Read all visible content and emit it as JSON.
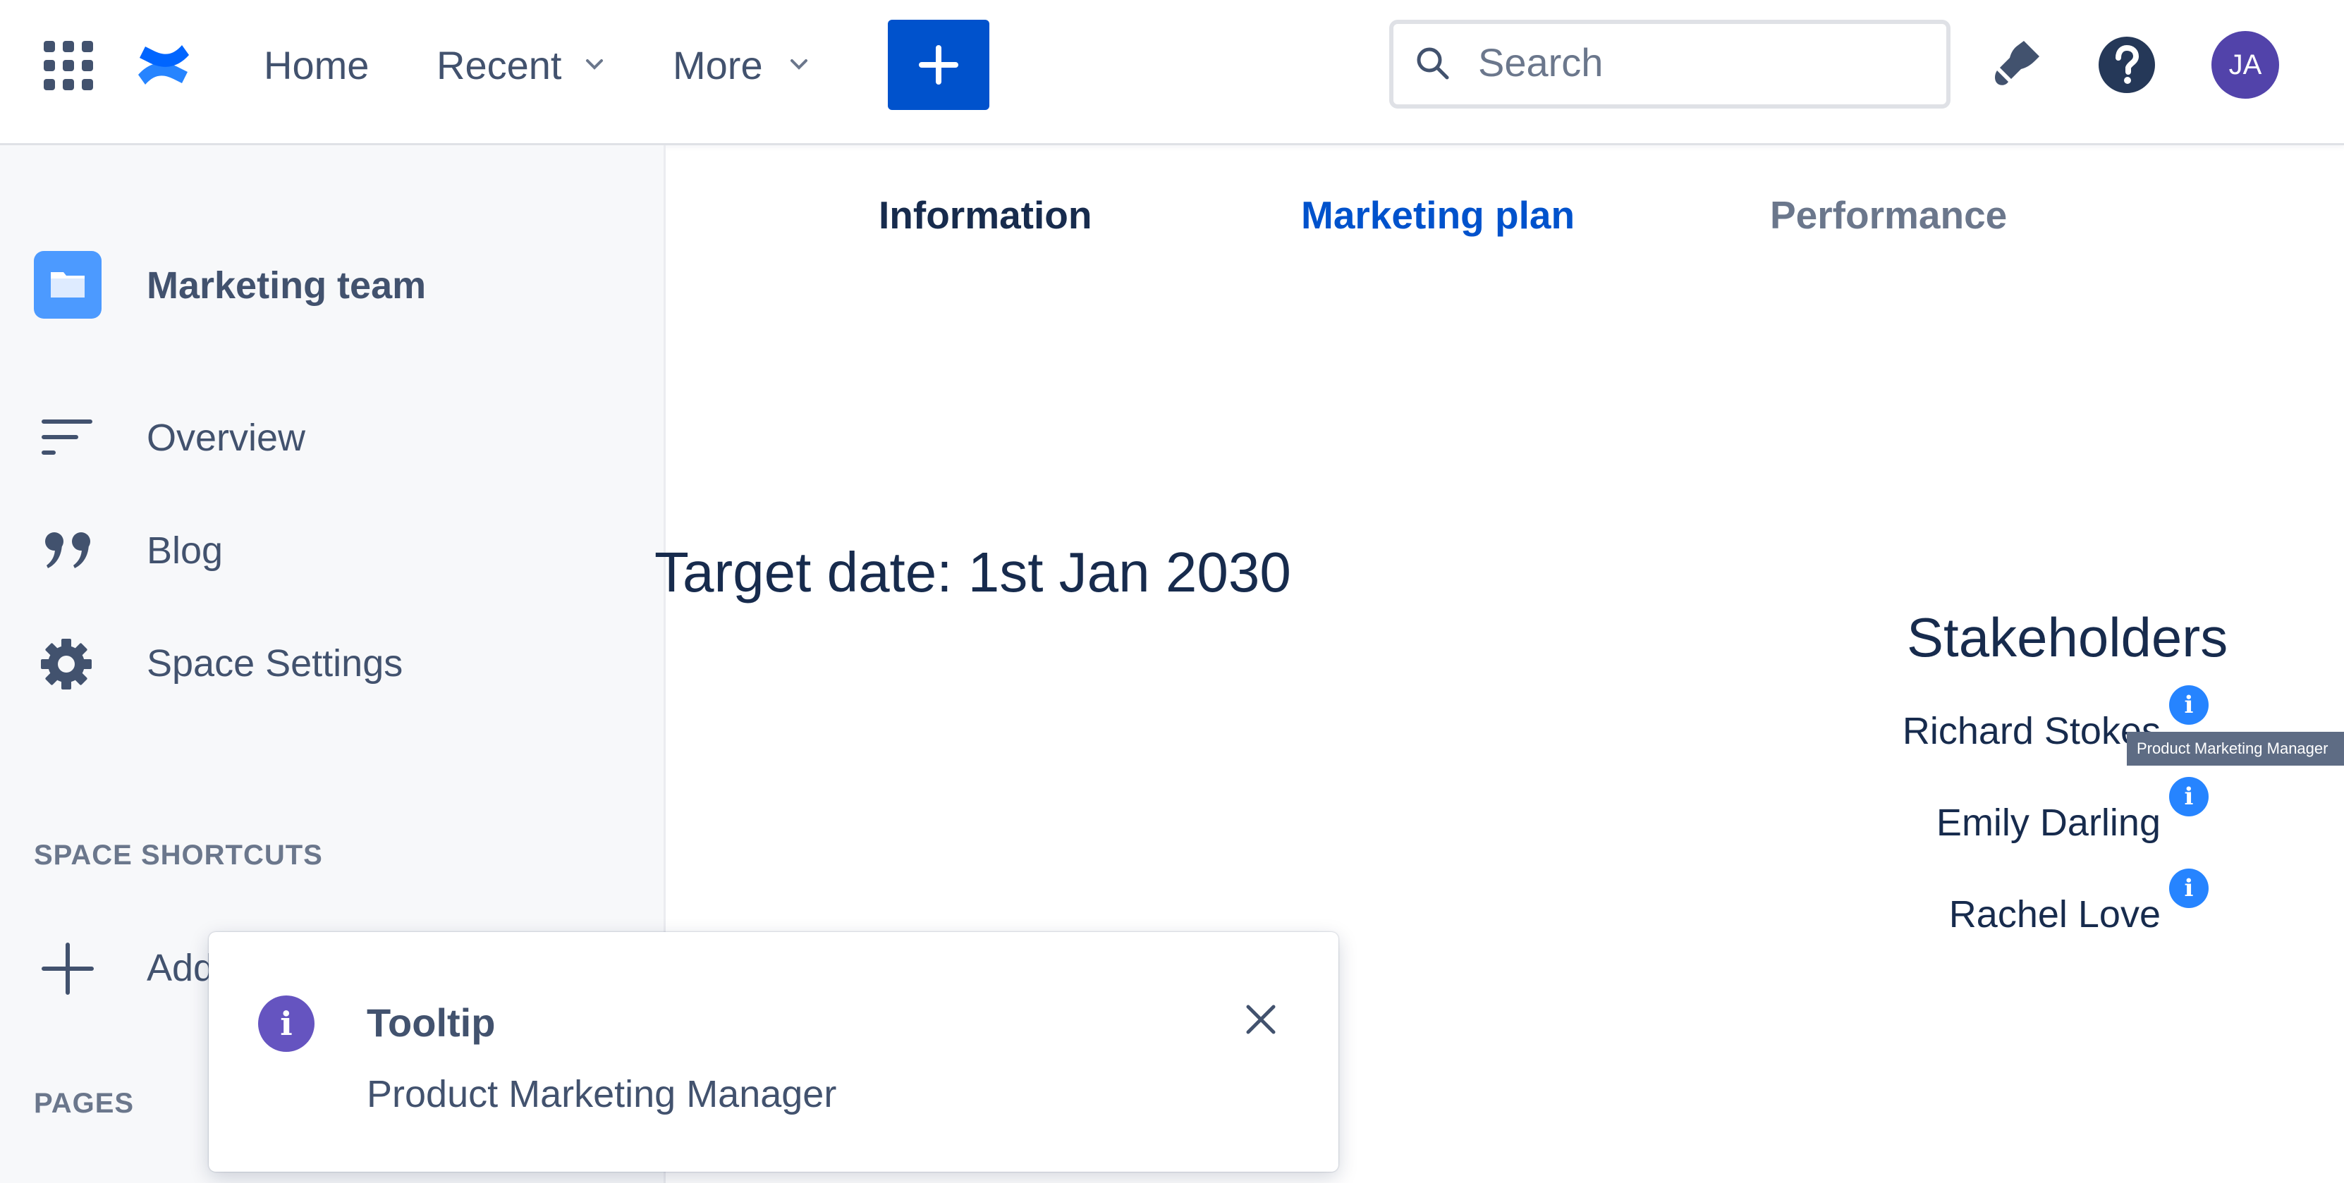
{
  "topnav": {
    "home": "Home",
    "recent": "Recent",
    "more": "More",
    "search_placeholder": "Search",
    "avatar_initials": "JA",
    "brand_color": "#0052cc"
  },
  "sidebar": {
    "space_name": "Marketing team",
    "items": [
      {
        "label": "Overview",
        "icon": "overview-lines-icon"
      },
      {
        "label": "Blog",
        "icon": "quote-icon"
      },
      {
        "label": "Space Settings",
        "icon": "gear-icon"
      }
    ],
    "shortcuts_header": "SPACE SHORTCUTS",
    "add_shortcut": "Add shortcut",
    "pages_header": "PAGES"
  },
  "tabs": [
    {
      "label": "Information",
      "state": "default"
    },
    {
      "label": "Marketing plan",
      "state": "active"
    },
    {
      "label": "Performance",
      "state": "muted"
    }
  ],
  "main": {
    "target_date": "Target date: 1st Jan 2030",
    "stakeholders_title": "Stakeholders",
    "stakeholders": [
      "Richard Stokes",
      "Emily Darling",
      "Rachel Love"
    ],
    "hover_tooltip": "Product Marketing Manager"
  },
  "flag": {
    "title": "Tooltip",
    "body": "Product Marketing Manager",
    "icon": "info-icon",
    "icon_color": "#6554c0"
  }
}
